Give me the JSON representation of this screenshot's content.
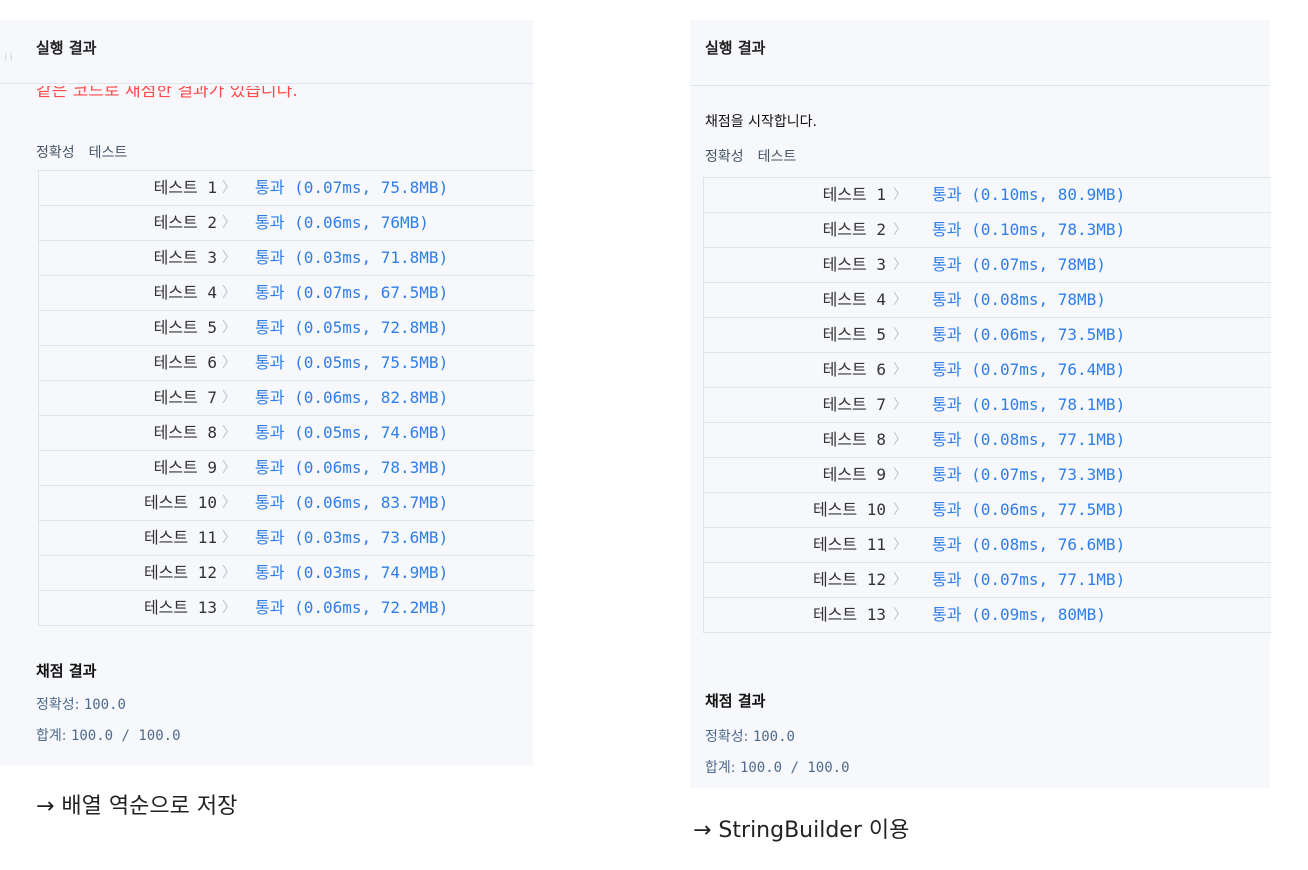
{
  "left": {
    "title": "실행 결과",
    "message": "같은 코드로 채점한 결과가 있습니다.",
    "tabs": [
      "정확성",
      "테스트"
    ],
    "tests": [
      {
        "label": "테스트 1",
        "result": "통과 (0.07ms, 75.8MB)"
      },
      {
        "label": "테스트 2",
        "result": "통과 (0.06ms, 76MB)"
      },
      {
        "label": "테스트 3",
        "result": "통과 (0.03ms, 71.8MB)"
      },
      {
        "label": "테스트 4",
        "result": "통과 (0.07ms, 67.5MB)"
      },
      {
        "label": "테스트 5",
        "result": "통과 (0.05ms, 72.8MB)"
      },
      {
        "label": "테스트 6",
        "result": "통과 (0.05ms, 75.5MB)"
      },
      {
        "label": "테스트 7",
        "result": "통과 (0.06ms, 82.8MB)"
      },
      {
        "label": "테스트 8",
        "result": "통과 (0.05ms, 74.6MB)"
      },
      {
        "label": "테스트 9",
        "result": "통과 (0.06ms, 78.3MB)"
      },
      {
        "label": "테스트 10",
        "result": "통과 (0.06ms, 83.7MB)"
      },
      {
        "label": "테스트 11",
        "result": "통과 (0.03ms, 73.6MB)"
      },
      {
        "label": "테스트 12",
        "result": "통과 (0.03ms, 74.9MB)"
      },
      {
        "label": "테스트 13",
        "result": "통과 (0.06ms, 72.2MB)"
      }
    ],
    "score_title": "채점 결과",
    "accuracy_key": "정확성:",
    "accuracy_value": "100.0",
    "total_key": "합계:",
    "total_value": "100.0 / 100.0",
    "caption": "→ 배열 역순으로 저장"
  },
  "right": {
    "title": "실행 결과",
    "message": "채점을 시작합니다.",
    "tabs": [
      "정확성",
      "테스트"
    ],
    "tests": [
      {
        "label": "테스트 1",
        "result": "통과 (0.10ms, 80.9MB)"
      },
      {
        "label": "테스트 2",
        "result": "통과 (0.10ms, 78.3MB)"
      },
      {
        "label": "테스트 3",
        "result": "통과 (0.07ms, 78MB)"
      },
      {
        "label": "테스트 4",
        "result": "통과 (0.08ms, 78MB)"
      },
      {
        "label": "테스트 5",
        "result": "통과 (0.06ms, 73.5MB)"
      },
      {
        "label": "테스트 6",
        "result": "통과 (0.07ms, 76.4MB)"
      },
      {
        "label": "테스트 7",
        "result": "통과 (0.10ms, 78.1MB)"
      },
      {
        "label": "테스트 8",
        "result": "통과 (0.08ms, 77.1MB)"
      },
      {
        "label": "테스트 9",
        "result": "통과 (0.07ms, 73.3MB)"
      },
      {
        "label": "테스트 10",
        "result": "통과 (0.06ms, 77.5MB)"
      },
      {
        "label": "테스트 11",
        "result": "통과 (0.08ms, 76.6MB)"
      },
      {
        "label": "테스트 12",
        "result": "통과 (0.07ms, 77.1MB)"
      },
      {
        "label": "테스트 13",
        "result": "통과 (0.09ms, 80MB)"
      }
    ],
    "score_title": "채점 결과",
    "accuracy_key": "정확성:",
    "accuracy_value": "100.0",
    "total_key": "합계:",
    "total_value": "100.0 / 100.0",
    "caption": "→ StringBuilder 이용"
  },
  "colors": {
    "pass": "#2f7ee8",
    "error_message": "#ff4b4b",
    "panel_bg": "#f7f8fb"
  },
  "icons": {
    "row_chevron": "chevron-right-icon",
    "drag_handle": "drag-handle-icon"
  }
}
